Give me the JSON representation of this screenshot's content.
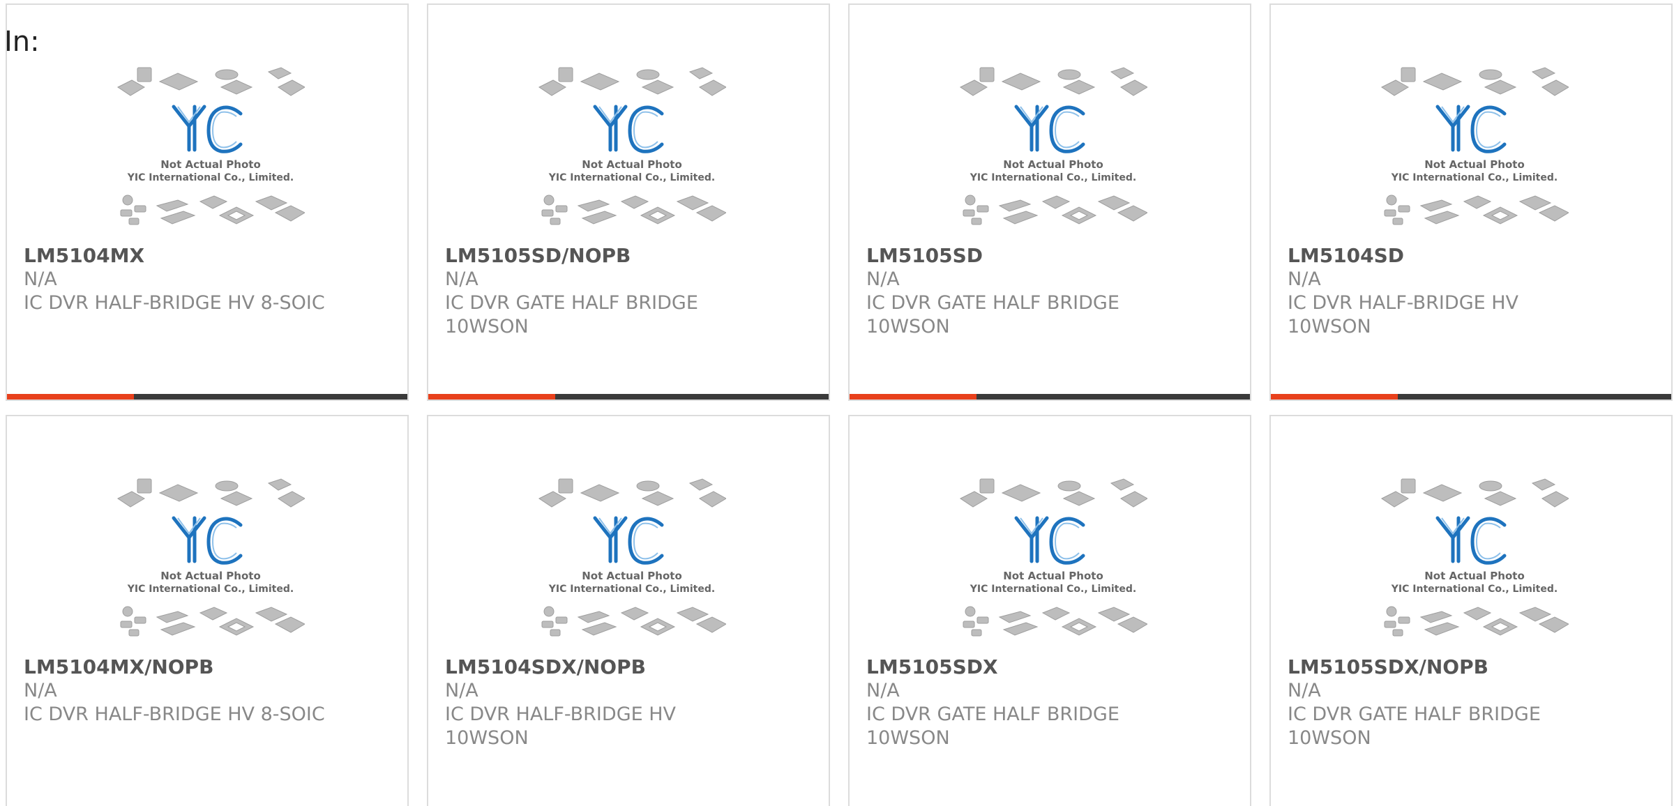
{
  "prefix": "In:",
  "theme": {
    "accent": "#e8401c",
    "bar": "#3a3a3a",
    "logo_blue": "#1e73be",
    "chip_gray": "#bdbdbd"
  },
  "placeholder": {
    "line1": "Not Actual Photo",
    "line2": "YIC International Co., Limited.",
    "logo_text": "YIC"
  },
  "products": [
    {
      "part": "LM5104MX",
      "manufacturer": "N/A",
      "description": "IC DVR HALF-BRIDGE HV 8-SOIC"
    },
    {
      "part": "LM5105SD/NOPB",
      "manufacturer": "N/A",
      "description": "IC DVR GATE HALF BRIDGE 10WSON"
    },
    {
      "part": "LM5105SD",
      "manufacturer": "N/A",
      "description": "IC DVR GATE HALF BRIDGE 10WSON"
    },
    {
      "part": "LM5104SD",
      "manufacturer": "N/A",
      "description": "IC DVR HALF-BRIDGE HV 10WSON"
    },
    {
      "part": "LM5104MX/NOPB",
      "manufacturer": "N/A",
      "description": "IC DVR HALF-BRIDGE HV 8-SOIC"
    },
    {
      "part": "LM5104SDX/NOPB",
      "manufacturer": "N/A",
      "description": "IC DVR HALF-BRIDGE HV 10WSON"
    },
    {
      "part": "LM5105SDX",
      "manufacturer": "N/A",
      "description": "IC DVR GATE HALF BRIDGE 10WSON"
    },
    {
      "part": "LM5105SDX/NOPB",
      "manufacturer": "N/A",
      "description": "IC DVR GATE HALF BRIDGE 10WSON"
    }
  ]
}
